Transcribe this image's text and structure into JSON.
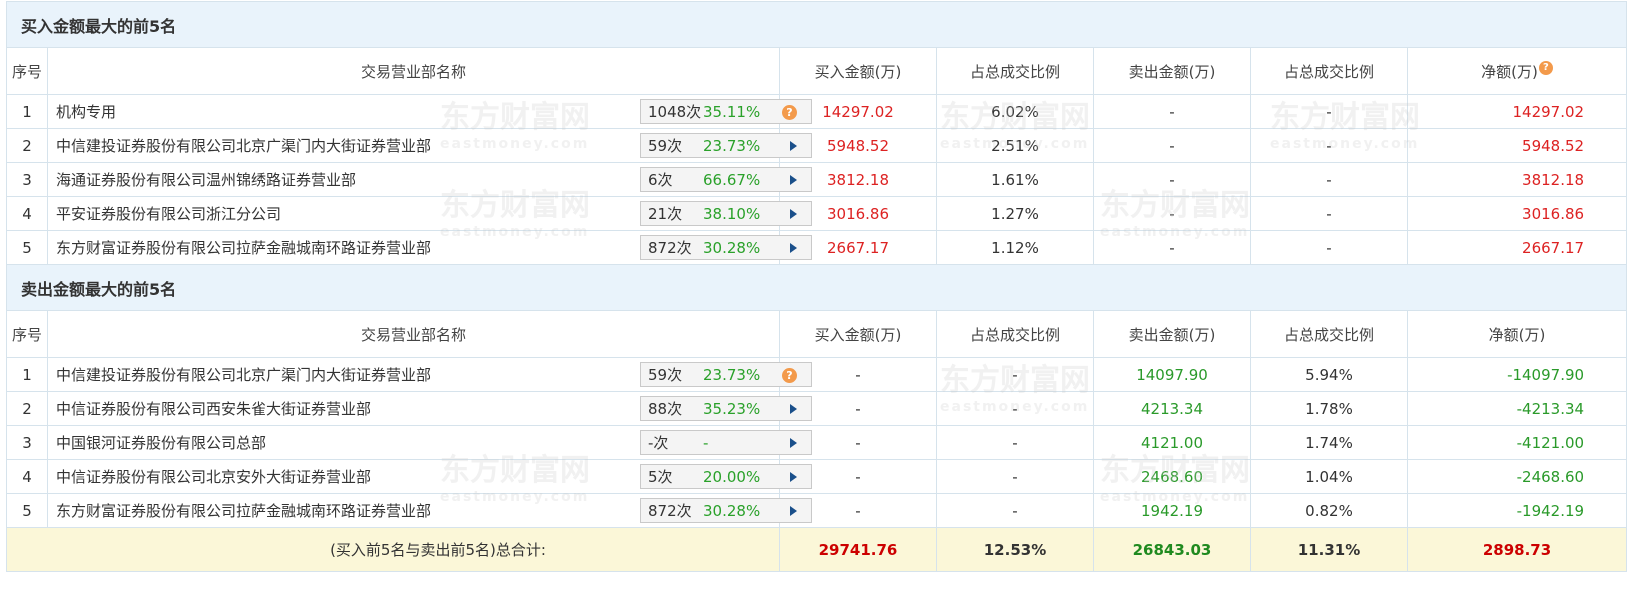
{
  "buy_section": {
    "title": "买入金额最大的前5名",
    "headers": [
      "序号",
      "交易营业部名称",
      "买入金额(万)",
      "占总成交比例",
      "卖出金额(万)",
      "占总成交比例",
      "净额(万)"
    ],
    "rows": [
      {
        "idx": "1",
        "name": "机构专用",
        "count": "1048次",
        "pct": "35.11%",
        "icon": "question-icon",
        "buy": "14297.02",
        "buy_ratio": "6.02%",
        "sell": "-",
        "sell_ratio": "-",
        "net": "14297.02"
      },
      {
        "idx": "2",
        "name": "中信建投证券股份有限公司北京广渠门内大街证券营业部",
        "count": "59次",
        "pct": "23.73%",
        "icon": "arrow-icon",
        "buy": "5948.52",
        "buy_ratio": "2.51%",
        "sell": "-",
        "sell_ratio": "-",
        "net": "5948.52"
      },
      {
        "idx": "3",
        "name": "海通证券股份有限公司温州锦绣路证券营业部",
        "count": "6次",
        "pct": "66.67%",
        "icon": "arrow-icon",
        "buy": "3812.18",
        "buy_ratio": "1.61%",
        "sell": "-",
        "sell_ratio": "-",
        "net": "3812.18"
      },
      {
        "idx": "4",
        "name": "平安证券股份有限公司浙江分公司",
        "count": "21次",
        "pct": "38.10%",
        "icon": "arrow-icon",
        "buy": "3016.86",
        "buy_ratio": "1.27%",
        "sell": "-",
        "sell_ratio": "-",
        "net": "3016.86"
      },
      {
        "idx": "5",
        "name": "东方财富证券股份有限公司拉萨金融城南环路证券营业部",
        "count": "872次",
        "pct": "30.28%",
        "icon": "arrow-icon",
        "buy": "2667.17",
        "buy_ratio": "1.12%",
        "sell": "-",
        "sell_ratio": "-",
        "net": "2667.17"
      }
    ]
  },
  "sell_section": {
    "title": "卖出金额最大的前5名",
    "headers": [
      "序号",
      "交易营业部名称",
      "买入金额(万)",
      "占总成交比例",
      "卖出金额(万)",
      "占总成交比例",
      "净额(万)"
    ],
    "rows": [
      {
        "idx": "1",
        "name": "中信建投证券股份有限公司北京广渠门内大街证券营业部",
        "count": "59次",
        "pct": "23.73%",
        "icon": "question-icon",
        "buy": "-",
        "buy_ratio": "-",
        "sell": "14097.90",
        "sell_ratio": "5.94%",
        "net": "-14097.90"
      },
      {
        "idx": "2",
        "name": "中信证券股份有限公司西安朱雀大街证券营业部",
        "count": "88次",
        "pct": "35.23%",
        "icon": "arrow-icon",
        "buy": "-",
        "buy_ratio": "-",
        "sell": "4213.34",
        "sell_ratio": "1.78%",
        "net": "-4213.34"
      },
      {
        "idx": "3",
        "name": "中国银河证券股份有限公司总部",
        "count": "-次",
        "pct": "-",
        "icon": "arrow-icon",
        "buy": "-",
        "buy_ratio": "-",
        "sell": "4121.00",
        "sell_ratio": "1.74%",
        "net": "-4121.00"
      },
      {
        "idx": "4",
        "name": "中信证券股份有限公司北京安外大街证券营业部",
        "count": "5次",
        "pct": "20.00%",
        "icon": "arrow-icon",
        "buy": "-",
        "buy_ratio": "-",
        "sell": "2468.60",
        "sell_ratio": "1.04%",
        "net": "-2468.60"
      },
      {
        "idx": "5",
        "name": "东方财富证券股份有限公司拉萨金融城南环路证券营业部",
        "count": "872次",
        "pct": "30.28%",
        "icon": "arrow-icon",
        "buy": "-",
        "buy_ratio": "-",
        "sell": "1942.19",
        "sell_ratio": "0.82%",
        "net": "-1942.19"
      }
    ]
  },
  "total": {
    "label": "(买入前5名与卖出前5名)总合计:",
    "buy": "29741.76",
    "buy_ratio": "12.53%",
    "sell": "26843.03",
    "sell_ratio": "11.31%",
    "net": "2898.73"
  },
  "watermark": {
    "cn": "东方财富网",
    "en": "eastmoney.com"
  },
  "colors": {
    "buy_red": "#dd2222",
    "sell_green": "#2a9a2a",
    "section_bg": "#e9f3fb",
    "total_bg": "#fbf7d8"
  }
}
